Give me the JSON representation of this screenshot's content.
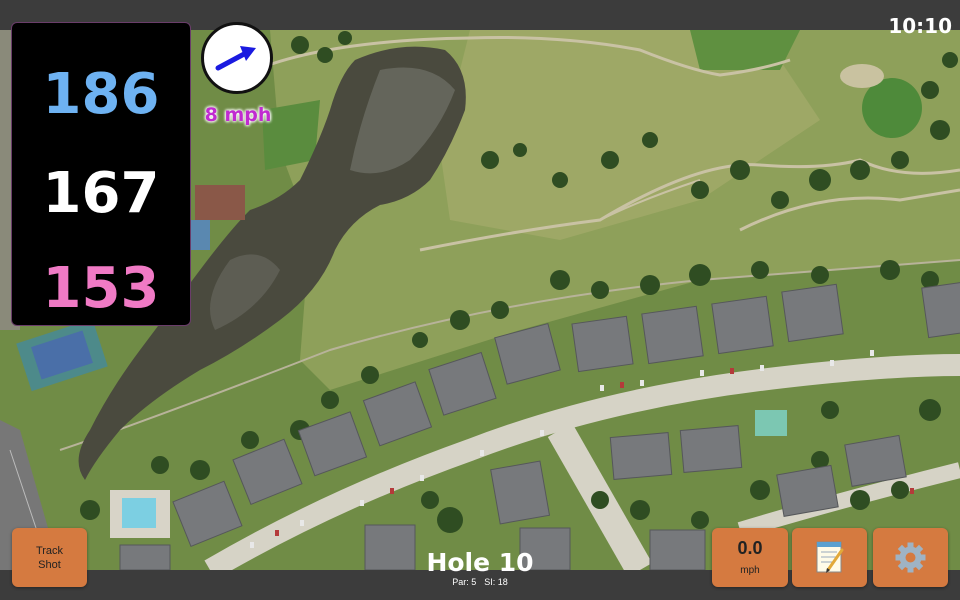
{
  "clock": "10:10",
  "distances": {
    "back": {
      "value": "186",
      "color": "#6eb2f2"
    },
    "middle": {
      "value": "167",
      "color": "#ffffff"
    },
    "front": {
      "value": "153",
      "color": "#f07ac5"
    }
  },
  "wind": {
    "speed_text": "8 mph",
    "arrow_icon": "wind-direction-arrow-icon",
    "arrow_color": "#1a1ae0"
  },
  "buttons": {
    "track_shot": "Track\nShot",
    "wind_value": "0.0",
    "wind_unit": "mph",
    "scorecard_icon": "notepad-icon",
    "settings_icon": "gear-icon"
  },
  "hole": {
    "title": "Hole 10",
    "par": "Par: 5",
    "si": "SI: 18"
  },
  "colors": {
    "button": "#d57a40",
    "bar": "#3c3c3c"
  }
}
